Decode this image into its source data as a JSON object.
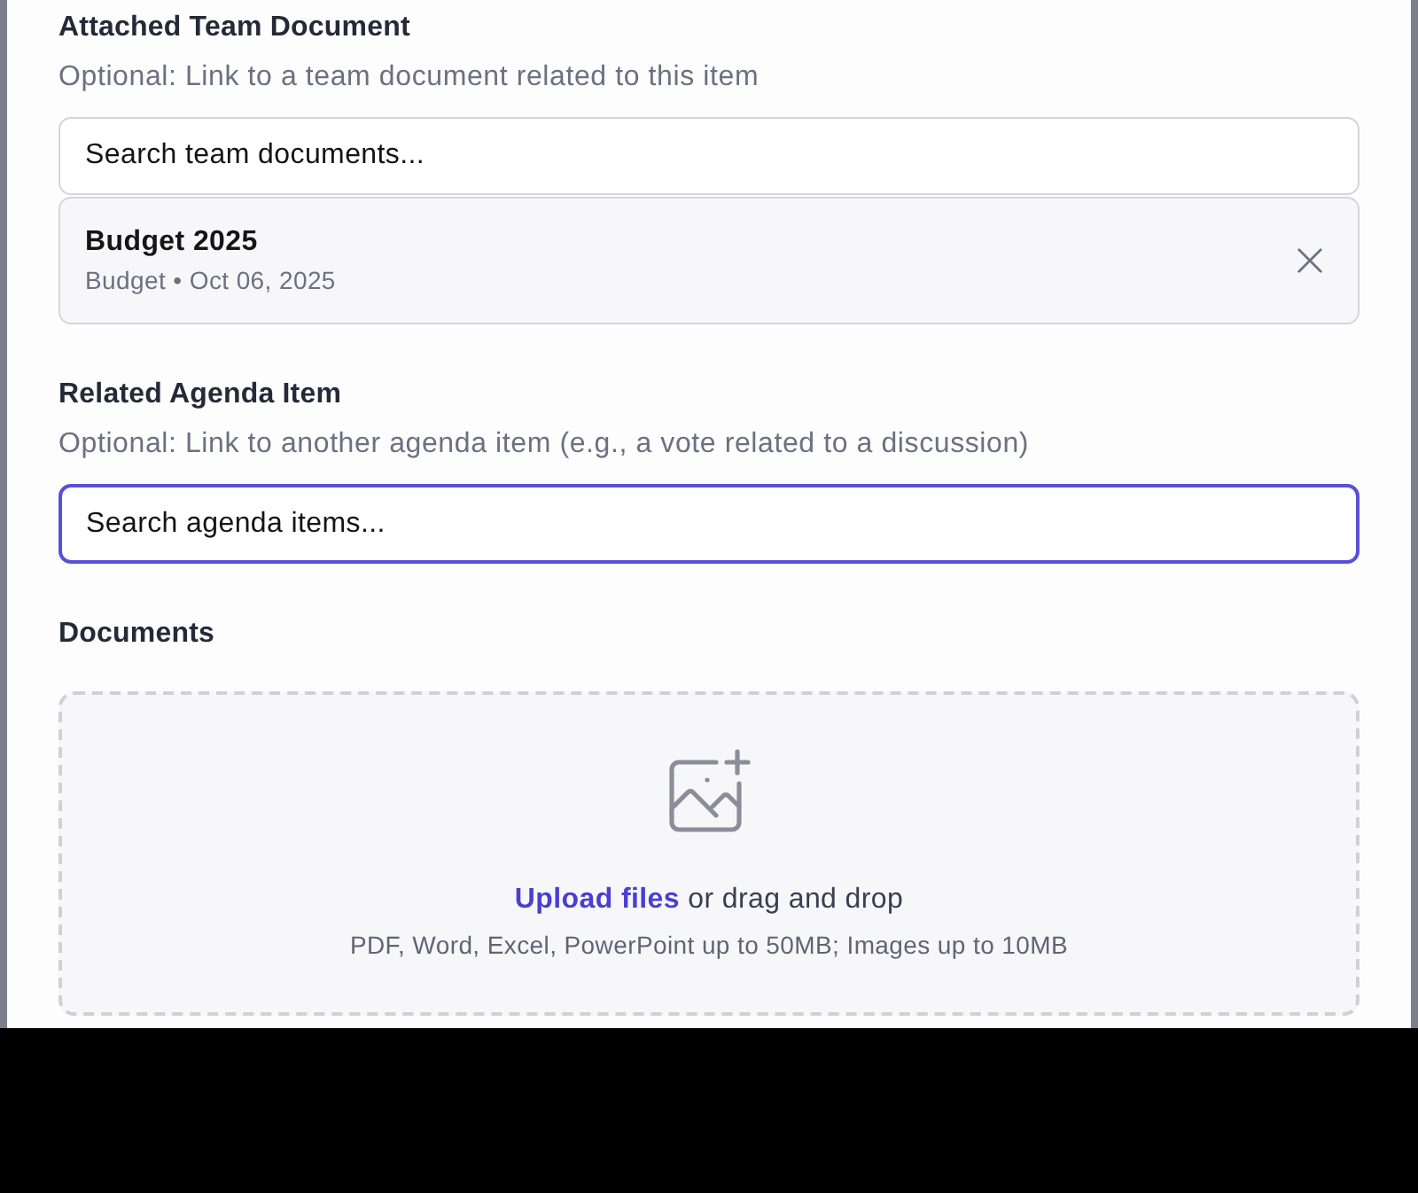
{
  "fields": [
    {
      "kind": "search",
      "label": "Attached Team Document",
      "hint": "Optional: Link to a team document related to this item",
      "search": {
        "placeholder": "Search team documents...",
        "focused": false
      },
      "selection": {
        "title": "Budget 2025",
        "meta": "Budget • Oct 06, 2025"
      }
    },
    {
      "kind": "search",
      "label": "Related Agenda Item",
      "hint": "Optional: Link to another agenda item (e.g., a vote related to a discussion)",
      "search": {
        "placeholder": "Search agenda items...",
        "focused": true
      }
    },
    {
      "kind": "upload",
      "label": "Documents",
      "dropzone": {
        "link": "Upload files",
        "text": "or drag and drop",
        "note": "PDF, Word, Excel, PowerPoint up to 50MB; Images up to 10MB"
      }
    }
  ]
}
